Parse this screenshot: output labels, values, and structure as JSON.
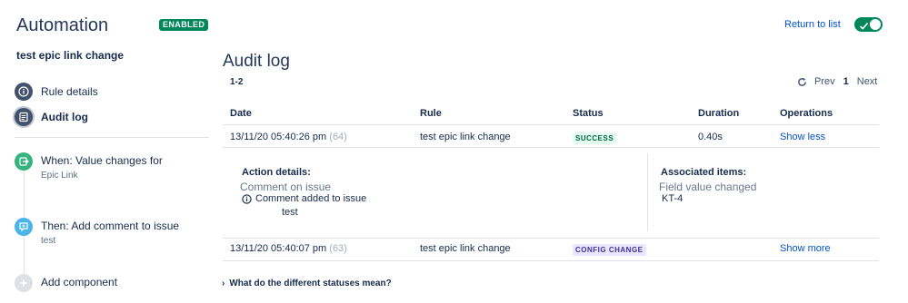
{
  "sidebar": {
    "app_title": "Automation",
    "status_badge": "ENABLED",
    "rule_name": "test epic link change",
    "nav": [
      {
        "label": "Rule details",
        "icon": "info-icon"
      },
      {
        "label": "Audit log",
        "icon": "document-icon"
      }
    ],
    "steps": [
      {
        "title": "When: Value changes for",
        "subtitle": "Epic Link",
        "icon": "trigger-icon",
        "color": "#36b37e"
      },
      {
        "title": "Then: Add comment to issue",
        "subtitle": "test",
        "icon": "comment-action-icon",
        "color": "#4cb5e8"
      },
      {
        "title": "Add component",
        "subtitle": "",
        "icon": "plus-icon",
        "color": "#dfe1e6"
      }
    ]
  },
  "header": {
    "return_link": "Return to list",
    "toggle_on": true
  },
  "main": {
    "title": "Audit log",
    "range": "1-2",
    "pager": {
      "prev": "Prev",
      "page": "1",
      "next": "Next"
    },
    "columns": [
      "Date",
      "Rule",
      "Status",
      "Duration",
      "Operations"
    ],
    "rows": [
      {
        "date": "13/11/20 05:40:26 pm",
        "count": "(64)",
        "rule": "test epic link change",
        "status": "SUCCESS",
        "duration": "0.40s",
        "operation": "Show less"
      },
      {
        "date": "13/11/20 05:40:07 pm",
        "count": "(63)",
        "rule": "test epic link change",
        "status": "CONFIG CHANGE",
        "duration": "",
        "operation": "Show more"
      }
    ],
    "details": {
      "action_label": "Action details:",
      "action_name": "Comment on issue",
      "action_message": "Comment added to issue",
      "action_value": "test",
      "assoc_label": "Associated items:",
      "assoc_name": "Field value changed",
      "assoc_key": "KT-4"
    },
    "faq": "What do the different statuses mean?"
  },
  "colors": {
    "enabled": "#00875a",
    "link": "#0052cc",
    "success_bg": "#e3fcef",
    "config_bg": "#eae6ff"
  }
}
